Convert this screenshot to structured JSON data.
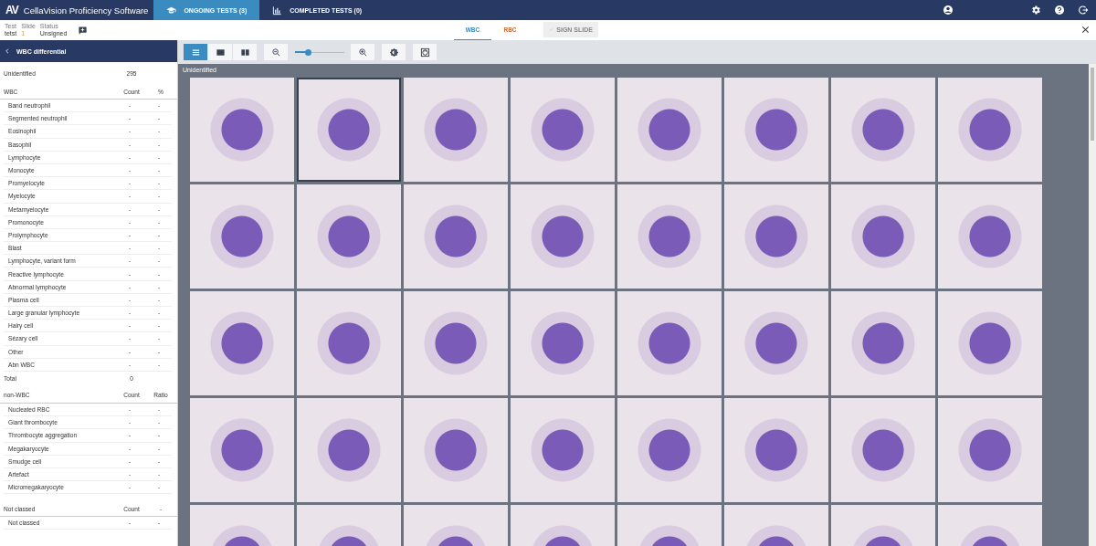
{
  "app": {
    "logo": "AV",
    "title": "CellaVision Proficiency Software",
    "tabs": [
      {
        "label": "ONGOING TESTS (3)",
        "selected": true
      },
      {
        "label": "COMPLETED TESTS (0)",
        "selected": false
      }
    ]
  },
  "info": {
    "fields": [
      {
        "label": "Test",
        "value": "tetst"
      },
      {
        "label": "Slide",
        "value": "1"
      },
      {
        "label": "Status",
        "value": "Unsigned"
      }
    ]
  },
  "view_tabs": [
    {
      "label": "WBC",
      "selected": true
    },
    {
      "label": "RBC",
      "selected": false
    }
  ],
  "sign_button": {
    "label": "SIGN SLIDE",
    "disabled": true
  },
  "panel": {
    "title": "WBC differential",
    "unidentified": {
      "label": "Unidentified",
      "count": "295"
    },
    "wbc": {
      "title": "WBC",
      "columns": [
        "Count",
        "%"
      ],
      "rows": [
        {
          "name": "Band neutrophil",
          "count": "-",
          "percent": "-"
        },
        {
          "name": "Segmented neutrophil",
          "count": "-",
          "percent": "-"
        },
        {
          "name": "Eosinophil",
          "count": "-",
          "percent": "-"
        },
        {
          "name": "Basophil",
          "count": "-",
          "percent": "-"
        },
        {
          "name": "Lymphocyte",
          "count": "-",
          "percent": "-"
        },
        {
          "name": "Monocyte",
          "count": "-",
          "percent": "-"
        },
        {
          "name": "Promyelocyte",
          "count": "-",
          "percent": "-"
        },
        {
          "name": "Myelocyte",
          "count": "-",
          "percent": "-"
        },
        {
          "name": "Metamyelocyte",
          "count": "-",
          "percent": "-"
        },
        {
          "name": "Promonocyte",
          "count": "-",
          "percent": "-"
        },
        {
          "name": "Prolymphocyte",
          "count": "-",
          "percent": "-"
        },
        {
          "name": "Blast",
          "count": "-",
          "percent": "-"
        },
        {
          "name": "Lymphocyte, variant form",
          "count": "-",
          "percent": "-"
        },
        {
          "name": "Reactive lymphocyte",
          "count": "-",
          "percent": "-"
        },
        {
          "name": "Abnormal lymphocyte",
          "count": "-",
          "percent": "-"
        },
        {
          "name": "Plasma cell",
          "count": "-",
          "percent": "-"
        },
        {
          "name": "Large granular lymphocyte",
          "count": "-",
          "percent": "-"
        },
        {
          "name": "Hairy cell",
          "count": "-",
          "percent": "-"
        },
        {
          "name": "Sézary cell",
          "count": "-",
          "percent": "-"
        },
        {
          "name": "Other",
          "count": "-",
          "percent": "-"
        },
        {
          "name": "Abn WBC",
          "count": "-",
          "percent": "-"
        }
      ]
    },
    "total": {
      "label": "Total",
      "value": "0"
    },
    "non_wbc": {
      "title": "non-WBC",
      "columns": [
        "Count",
        "Ratio"
      ],
      "rows": [
        {
          "name": "Nucleated RBC",
          "count": "-",
          "percent": "-"
        },
        {
          "name": "Giant thrombocyte",
          "count": "-",
          "percent": "-"
        },
        {
          "name": "Thrombocyte aggregation",
          "count": "-",
          "percent": "-"
        },
        {
          "name": "Megakaryocyte",
          "count": "-",
          "percent": "-"
        },
        {
          "name": "Smudge cell",
          "count": "-",
          "percent": "-"
        },
        {
          "name": "Artefact",
          "count": "-",
          "percent": "-"
        },
        {
          "name": "Micromegakaryocyte",
          "count": "-",
          "percent": "-"
        }
      ]
    },
    "not_classed": {
      "title": "Not classed",
      "columns": [
        "Count",
        "-"
      ],
      "rows": [
        {
          "name": "Not classed",
          "count": "-",
          "percent": "-"
        }
      ]
    }
  },
  "viewer": {
    "layout_modes": [
      {
        "kind": "list",
        "selected": true
      },
      {
        "kind": "single",
        "selected": false
      },
      {
        "kind": "double",
        "selected": false
      }
    ],
    "zoom": {
      "level": 0.27
    },
    "group_label": "Unidentified",
    "images": [
      {
        "selected": false
      },
      {
        "selected": true
      },
      {
        "selected": false
      },
      {
        "selected": false
      },
      {
        "selected": false
      },
      {
        "selected": false
      },
      {
        "selected": false
      },
      {
        "selected": false
      },
      {
        "selected": false
      },
      {
        "selected": false
      },
      {
        "selected": false
      },
      {
        "selected": false
      },
      {
        "selected": false
      },
      {
        "selected": false
      },
      {
        "selected": false
      },
      {
        "selected": false
      },
      {
        "selected": false
      },
      {
        "selected": false
      },
      {
        "selected": false
      },
      {
        "selected": false
      },
      {
        "selected": false
      },
      {
        "selected": false
      },
      {
        "selected": false
      },
      {
        "selected": false
      },
      {
        "selected": false
      },
      {
        "selected": false
      },
      {
        "selected": false
      },
      {
        "selected": false
      },
      {
        "selected": false
      },
      {
        "selected": false
      },
      {
        "selected": false
      },
      {
        "selected": false
      },
      {
        "selected": false
      },
      {
        "selected": false
      },
      {
        "selected": false
      },
      {
        "selected": false
      },
      {
        "selected": false
      },
      {
        "selected": false
      },
      {
        "selected": false
      },
      {
        "selected": false
      }
    ]
  }
}
